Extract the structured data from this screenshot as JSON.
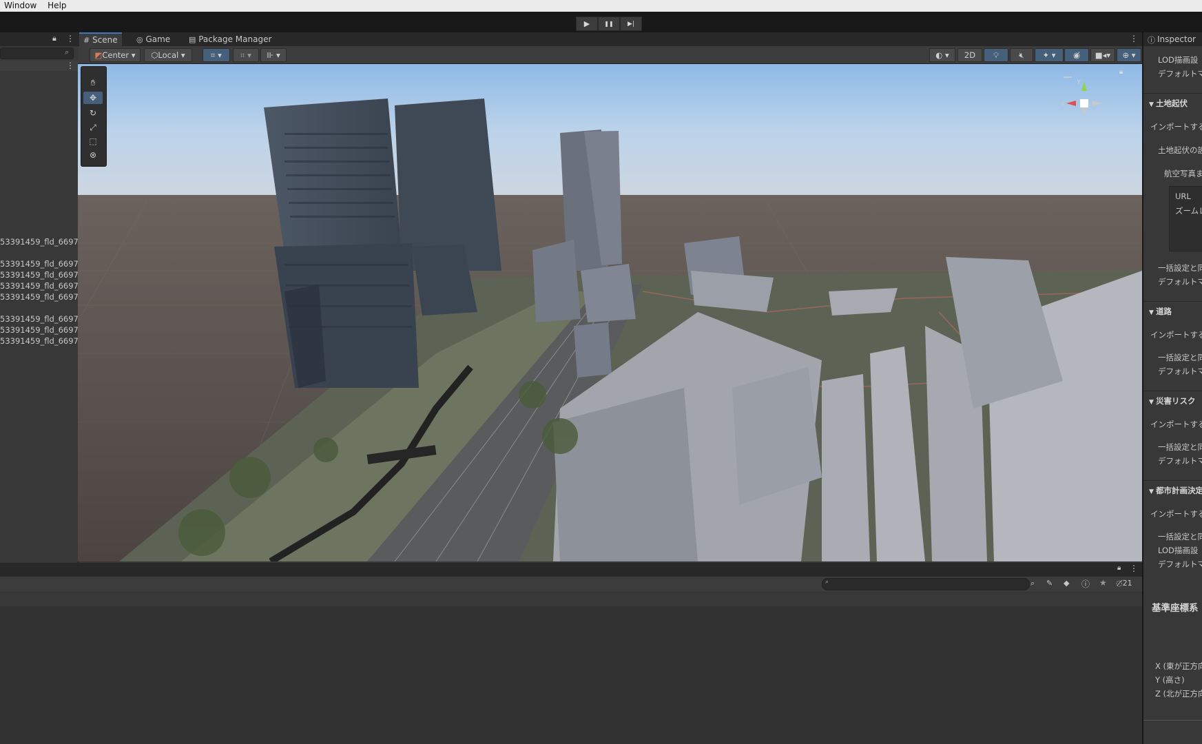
{
  "menubar": {
    "items": [
      "Window",
      "Help"
    ]
  },
  "playbar": {
    "play": "▶",
    "pause": "❚❚",
    "step": "▶|"
  },
  "hierarchy": {
    "items": [
      "53391459_fld_6697_",
      "53391459_fld_6697_",
      "53391459_fld_6697_",
      "53391459_fld_6697_",
      "53391459_fld_6697_",
      "53391459_fld_6697_",
      "53391459_fld_6697_",
      "53391459_fld_6697_"
    ]
  },
  "scene": {
    "tabs": [
      "Scene",
      "Game",
      "Package Manager"
    ],
    "pivot": "Center",
    "space": "Local",
    "toggle_2d": "2D"
  },
  "console": {
    "count": "21"
  },
  "inspector": {
    "tab": "Inspector",
    "lines": {
      "lod1": "LOD描画設",
      "default1": "デフォルトマテ",
      "terrain_head": "土地起伏",
      "terrain_import": "インポートする",
      "terrain_setting": "土地起伏の設",
      "aerial": "航空写真ま",
      "url": "URL",
      "zoom": "ズームレ",
      "batch1": "一括設定と同",
      "default2": "デフォルトマテ",
      "road_head": "道路",
      "road_import": "インポートする",
      "batch2": "一括設定と同",
      "default3": "デフォルトマテ",
      "disaster_head": "災害リスク",
      "disaster_import": "インポートする",
      "batch3": "一括設定と同",
      "default4": "デフォルトマテ",
      "urban_head": "都市計画決定",
      "urban_import": "インポートする",
      "batch4": "一括設定と同",
      "lod2": "LOD描画設",
      "default5": "デフォルトマテ",
      "coord_head": "基準座標系",
      "x": "X (東が正方向",
      "y": "Y (高さ)",
      "z": "Z (北が正方向"
    }
  },
  "colors": {
    "accent": "#3a79bb",
    "active_tool": "#46607c",
    "sky_top": "#9fc2e8",
    "ground": "#57504c"
  }
}
